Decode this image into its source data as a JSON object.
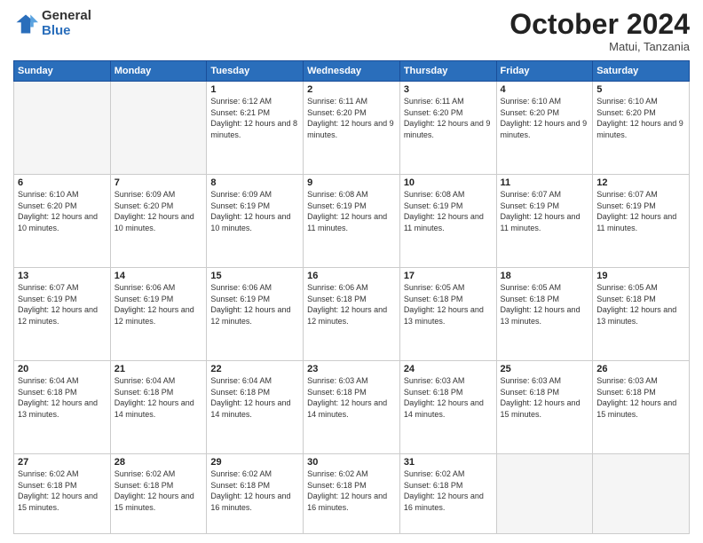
{
  "logo": {
    "general": "General",
    "blue": "Blue"
  },
  "header": {
    "month": "October 2024",
    "location": "Matui, Tanzania"
  },
  "weekdays": [
    "Sunday",
    "Monday",
    "Tuesday",
    "Wednesday",
    "Thursday",
    "Friday",
    "Saturday"
  ],
  "weeks": [
    [
      {
        "day": "",
        "empty": true
      },
      {
        "day": "",
        "empty": true
      },
      {
        "day": "1",
        "sunrise": "6:12 AM",
        "sunset": "6:21 PM",
        "daylight": "12 hours and 8 minutes."
      },
      {
        "day": "2",
        "sunrise": "6:11 AM",
        "sunset": "6:20 PM",
        "daylight": "12 hours and 9 minutes."
      },
      {
        "day": "3",
        "sunrise": "6:11 AM",
        "sunset": "6:20 PM",
        "daylight": "12 hours and 9 minutes."
      },
      {
        "day": "4",
        "sunrise": "6:10 AM",
        "sunset": "6:20 PM",
        "daylight": "12 hours and 9 minutes."
      },
      {
        "day": "5",
        "sunrise": "6:10 AM",
        "sunset": "6:20 PM",
        "daylight": "12 hours and 9 minutes."
      }
    ],
    [
      {
        "day": "6",
        "sunrise": "6:10 AM",
        "sunset": "6:20 PM",
        "daylight": "12 hours and 10 minutes."
      },
      {
        "day": "7",
        "sunrise": "6:09 AM",
        "sunset": "6:20 PM",
        "daylight": "12 hours and 10 minutes."
      },
      {
        "day": "8",
        "sunrise": "6:09 AM",
        "sunset": "6:19 PM",
        "daylight": "12 hours and 10 minutes."
      },
      {
        "day": "9",
        "sunrise": "6:08 AM",
        "sunset": "6:19 PM",
        "daylight": "12 hours and 11 minutes."
      },
      {
        "day": "10",
        "sunrise": "6:08 AM",
        "sunset": "6:19 PM",
        "daylight": "12 hours and 11 minutes."
      },
      {
        "day": "11",
        "sunrise": "6:07 AM",
        "sunset": "6:19 PM",
        "daylight": "12 hours and 11 minutes."
      },
      {
        "day": "12",
        "sunrise": "6:07 AM",
        "sunset": "6:19 PM",
        "daylight": "12 hours and 11 minutes."
      }
    ],
    [
      {
        "day": "13",
        "sunrise": "6:07 AM",
        "sunset": "6:19 PM",
        "daylight": "12 hours and 12 minutes."
      },
      {
        "day": "14",
        "sunrise": "6:06 AM",
        "sunset": "6:19 PM",
        "daylight": "12 hours and 12 minutes."
      },
      {
        "day": "15",
        "sunrise": "6:06 AM",
        "sunset": "6:19 PM",
        "daylight": "12 hours and 12 minutes."
      },
      {
        "day": "16",
        "sunrise": "6:06 AM",
        "sunset": "6:18 PM",
        "daylight": "12 hours and 12 minutes."
      },
      {
        "day": "17",
        "sunrise": "6:05 AM",
        "sunset": "6:18 PM",
        "daylight": "12 hours and 13 minutes."
      },
      {
        "day": "18",
        "sunrise": "6:05 AM",
        "sunset": "6:18 PM",
        "daylight": "12 hours and 13 minutes."
      },
      {
        "day": "19",
        "sunrise": "6:05 AM",
        "sunset": "6:18 PM",
        "daylight": "12 hours and 13 minutes."
      }
    ],
    [
      {
        "day": "20",
        "sunrise": "6:04 AM",
        "sunset": "6:18 PM",
        "daylight": "12 hours and 13 minutes."
      },
      {
        "day": "21",
        "sunrise": "6:04 AM",
        "sunset": "6:18 PM",
        "daylight": "12 hours and 14 minutes."
      },
      {
        "day": "22",
        "sunrise": "6:04 AM",
        "sunset": "6:18 PM",
        "daylight": "12 hours and 14 minutes."
      },
      {
        "day": "23",
        "sunrise": "6:03 AM",
        "sunset": "6:18 PM",
        "daylight": "12 hours and 14 minutes."
      },
      {
        "day": "24",
        "sunrise": "6:03 AM",
        "sunset": "6:18 PM",
        "daylight": "12 hours and 14 minutes."
      },
      {
        "day": "25",
        "sunrise": "6:03 AM",
        "sunset": "6:18 PM",
        "daylight": "12 hours and 15 minutes."
      },
      {
        "day": "26",
        "sunrise": "6:03 AM",
        "sunset": "6:18 PM",
        "daylight": "12 hours and 15 minutes."
      }
    ],
    [
      {
        "day": "27",
        "sunrise": "6:02 AM",
        "sunset": "6:18 PM",
        "daylight": "12 hours and 15 minutes."
      },
      {
        "day": "28",
        "sunrise": "6:02 AM",
        "sunset": "6:18 PM",
        "daylight": "12 hours and 15 minutes."
      },
      {
        "day": "29",
        "sunrise": "6:02 AM",
        "sunset": "6:18 PM",
        "daylight": "12 hours and 16 minutes."
      },
      {
        "day": "30",
        "sunrise": "6:02 AM",
        "sunset": "6:18 PM",
        "daylight": "12 hours and 16 minutes."
      },
      {
        "day": "31",
        "sunrise": "6:02 AM",
        "sunset": "6:18 PM",
        "daylight": "12 hours and 16 minutes."
      },
      {
        "day": "",
        "empty": true
      },
      {
        "day": "",
        "empty": true
      }
    ]
  ],
  "labels": {
    "sunrise": "Sunrise:",
    "sunset": "Sunset:",
    "daylight": "Daylight:"
  }
}
